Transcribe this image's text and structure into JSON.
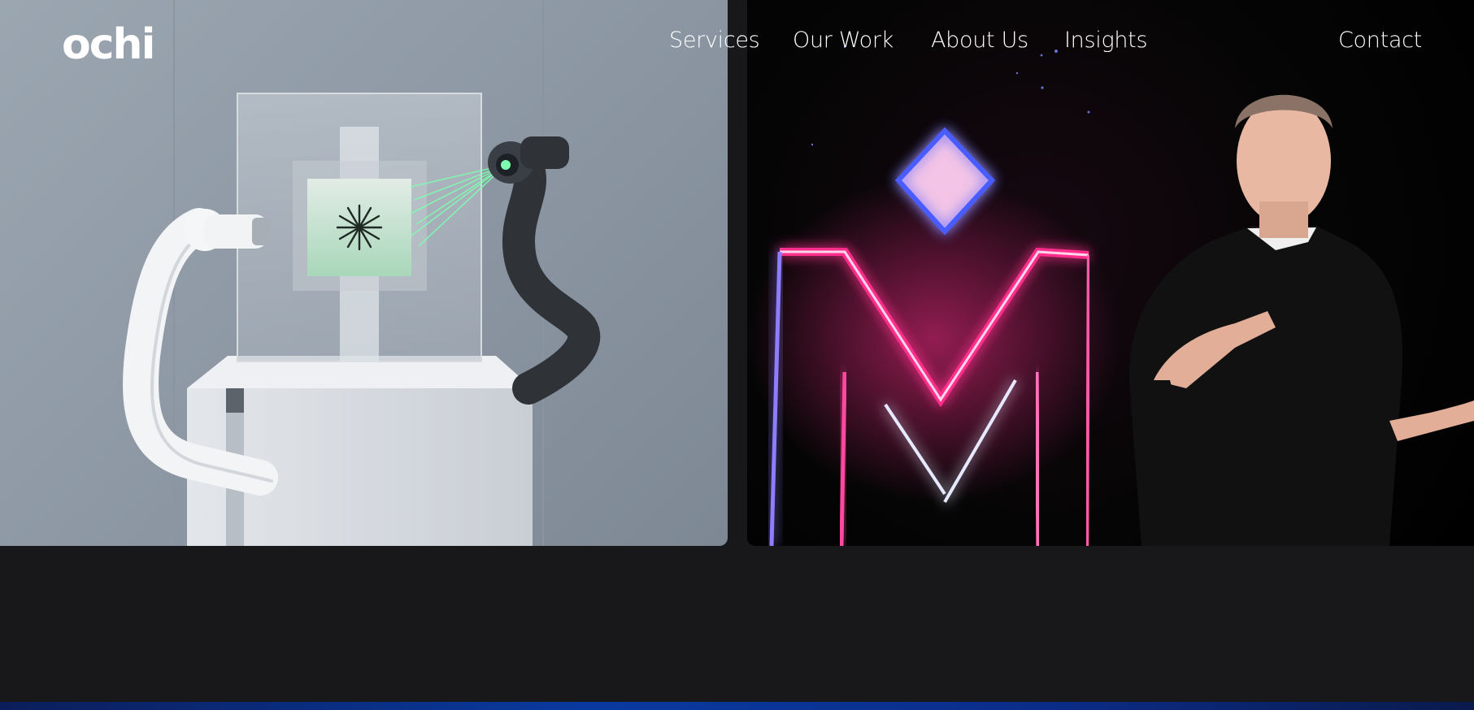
{
  "brand": {
    "logo_text": "ochi"
  },
  "nav": {
    "links": [
      {
        "label": "Services"
      },
      {
        "label": "Our Work"
      },
      {
        "label": "About Us"
      },
      {
        "label": "Insights"
      }
    ],
    "contact_label": "Contact"
  },
  "colors": {
    "page_background": "#18181b",
    "text": "#ffffff",
    "left_card_background": "#8e99a5",
    "right_card_background": "#050505",
    "neon_pink": "#ff2f8c",
    "neon_blue": "#4a5bff",
    "laser_green": "#7dffb0",
    "bottom_strip": "#0a3aa0"
  },
  "hero_cards": [
    {
      "id": "robotics-card",
      "icons": [
        "robot-arm-icon",
        "sunburst-icon"
      ]
    },
    {
      "id": "keynote-card",
      "icons": [
        "neon-m-icon"
      ]
    }
  ]
}
